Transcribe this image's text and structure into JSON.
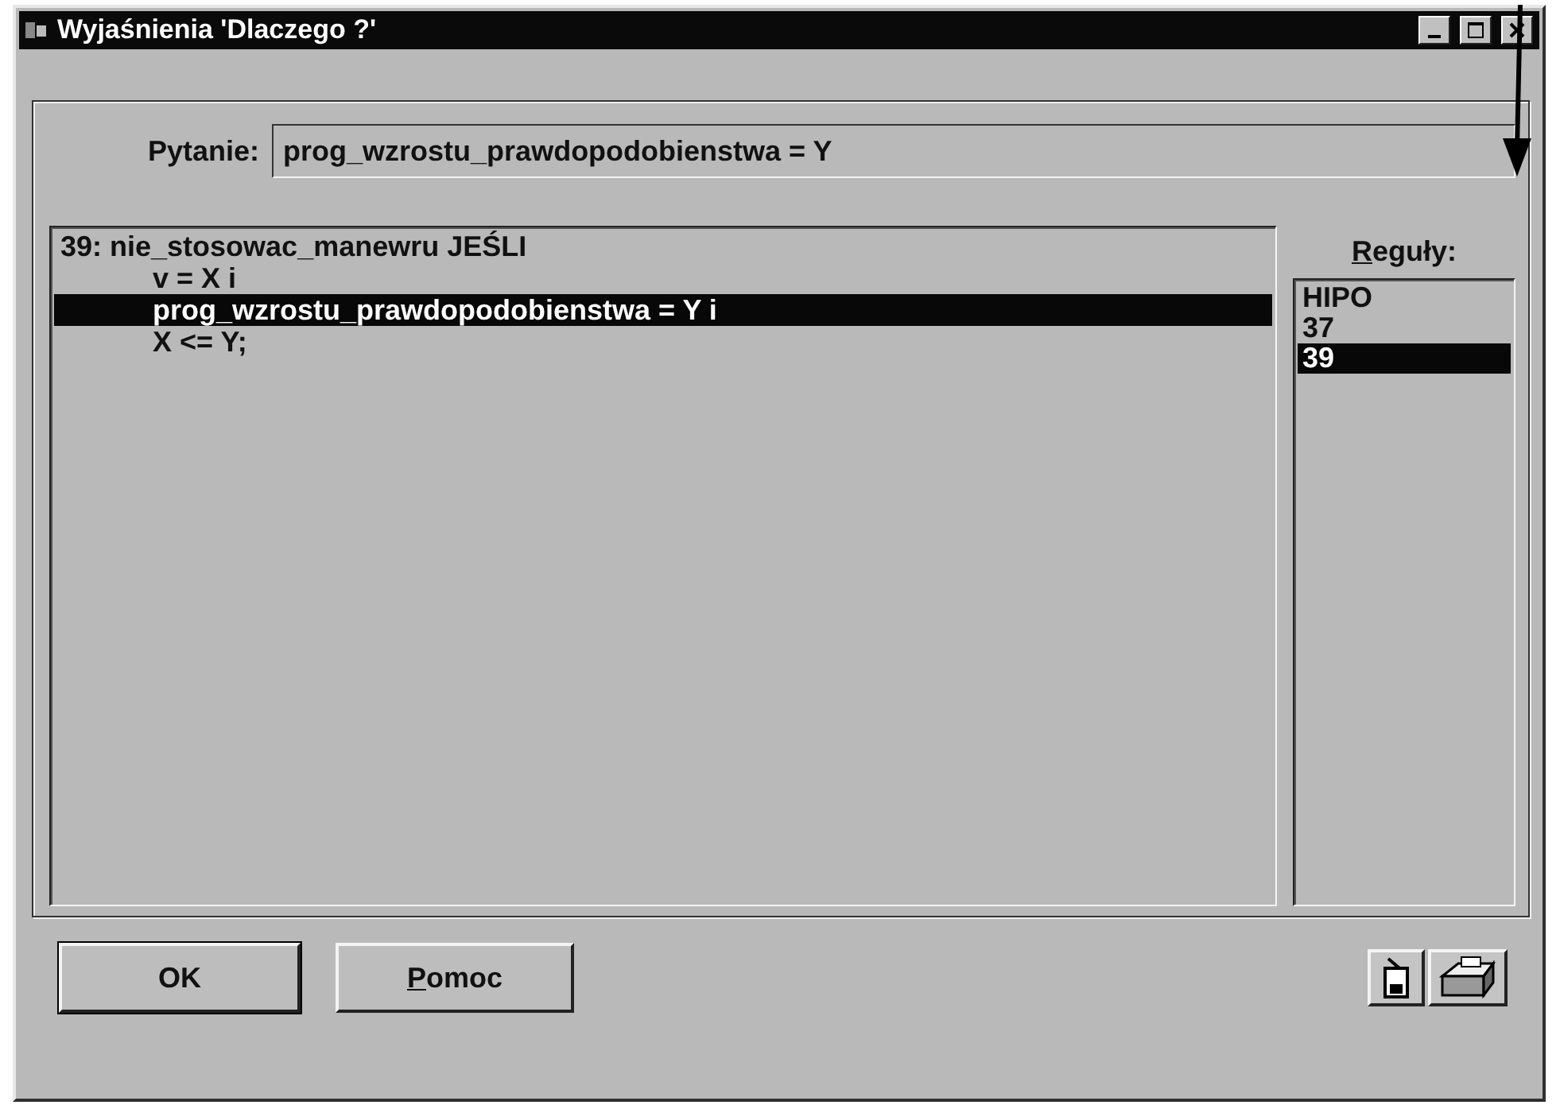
{
  "window": {
    "title": "Wyjaśnienia 'Dlaczego ?'"
  },
  "question": {
    "label": "Pytanie:",
    "value": "prog_wzrostu_prawdopodobienstwa = Y"
  },
  "explanation": {
    "lines": [
      {
        "text": "39: nie_stosowac_manewru JEŚLI",
        "kind": "head",
        "selected": false
      },
      {
        "text": "v = X i",
        "kind": "condition",
        "selected": false
      },
      {
        "text": "prog_wzrostu_prawdopodobienstwa = Y i",
        "kind": "condition",
        "selected": true
      },
      {
        "text": "X <= Y;",
        "kind": "condition",
        "selected": false
      }
    ]
  },
  "rules": {
    "label": "Reguły:",
    "items": [
      {
        "text": "HIPO",
        "selected": false
      },
      {
        "text": "37",
        "selected": false
      },
      {
        "text": "39",
        "selected": true
      }
    ]
  },
  "buttons": [
    {
      "label": "OK",
      "default": true
    },
    {
      "label": "Pomoc",
      "default": false
    }
  ]
}
